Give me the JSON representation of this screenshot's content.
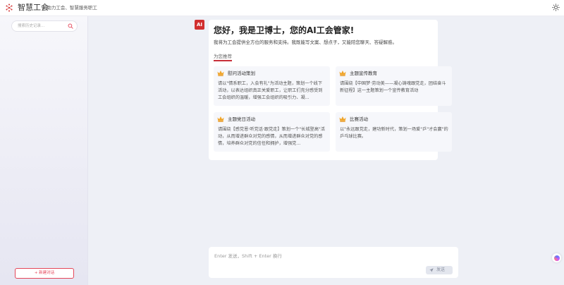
{
  "app": {
    "brand": "智慧工会",
    "tagline": "AI助力工会、智慧服务职工",
    "icons": {
      "logo": "hexagon-dots-logo",
      "theme": "sun-icon"
    }
  },
  "sidebar": {
    "search": {
      "placeholder": "搜索历史记录...",
      "value": ""
    },
    "new_chat_label": "+ 新建对话"
  },
  "welcome": {
    "avatar": "AI",
    "title": "您好，我是卫博士，您的AI工会管家!",
    "subtitle": "我将为工会提供全方位的服务和支持。我既能写文案、想点子，又能陪您聊天、答疑解惑。",
    "recommend_label": "为您推荐",
    "cards": [
      {
        "title": "慰问活动策划",
        "desc": "请以\"情系职工，入会有礼\"为活动主题，策划一个线下活动，以表达组织真正关爱职工，让职工们充分感受到工会组织的温暖，增强工会组织的吸引力、凝..."
      },
      {
        "title": "主题宣传教育",
        "desc": "请围绕【中国梦·劳动美——凝心铸魂跟党走，团结奋斗新征程】这一主题策划一个宣传教育活动"
      },
      {
        "title": "主题党日活动",
        "desc": "请围绕【感党恩·听党话·跟党走】策划一个\"长城登高\"活动，从而增进群众对党的感情，从而增进群众对党的感情，培养群众对党的信任和拥护，增强党..."
      },
      {
        "title": "比赛活动",
        "desc": "以\"永远跟党走，建功新时代，策划一场爱\"乒\"才会赢\"的乒乓球比赛。"
      }
    ]
  },
  "composer": {
    "placeholder": "Enter 发送，Shift + Enter 换行",
    "value": "",
    "send_label": "发送"
  },
  "colors": {
    "accent": "#d12f2f",
    "new_chat": "#e4465a",
    "crown": "#f0a52b"
  }
}
